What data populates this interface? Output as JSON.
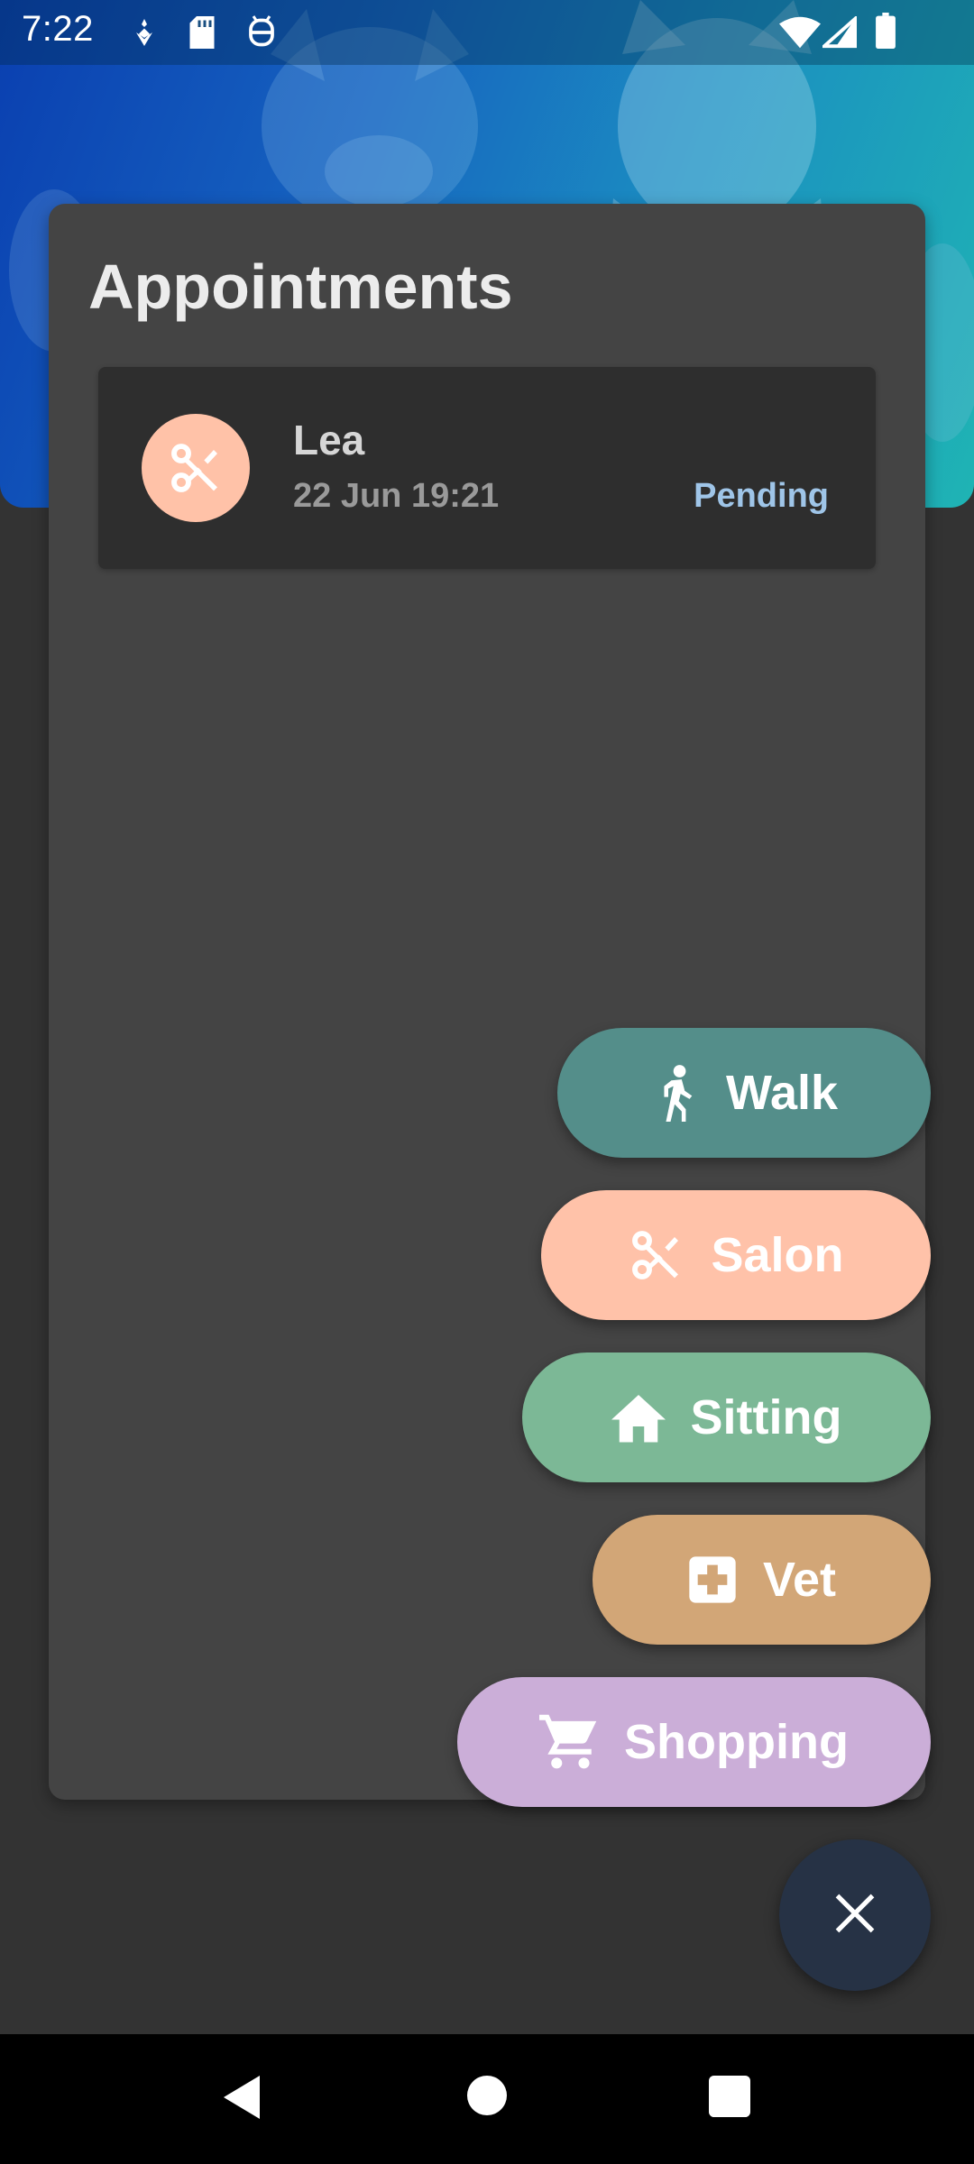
{
  "status_bar": {
    "time": "7:22",
    "icons": [
      "notification-icon",
      "sd-card-icon",
      "android-debug-icon",
      "wifi-icon",
      "cell-signal-icon",
      "battery-icon"
    ]
  },
  "appointments": {
    "title": "Appointments",
    "items": [
      {
        "name": "Lea",
        "datetime": "22 Jun 19:21",
        "status": "Pending",
        "icon": "scissors-icon",
        "icon_bg": "#ffc2a8"
      }
    ]
  },
  "speed_dial": {
    "actions": [
      {
        "label": "Walk",
        "icon": "walk-icon",
        "color": "#548e8a"
      },
      {
        "label": "Salon",
        "icon": "scissors-icon",
        "color": "#ffc2a9"
      },
      {
        "label": "Sitting",
        "icon": "home-icon",
        "color": "#7cb896"
      },
      {
        "label": "Vet",
        "icon": "medical-cross-icon",
        "color": "#d2a677"
      },
      {
        "label": "Shopping",
        "icon": "cart-icon",
        "color": "#cbaed8"
      }
    ],
    "fab_icon": "close-icon",
    "fab_color": "#263245"
  },
  "nav_bar": {
    "buttons": [
      "back-icon",
      "home-nav-icon",
      "recents-icon"
    ]
  },
  "colors": {
    "background": "#333333",
    "card": "#444444",
    "status_pending": "#9fc5e8"
  }
}
